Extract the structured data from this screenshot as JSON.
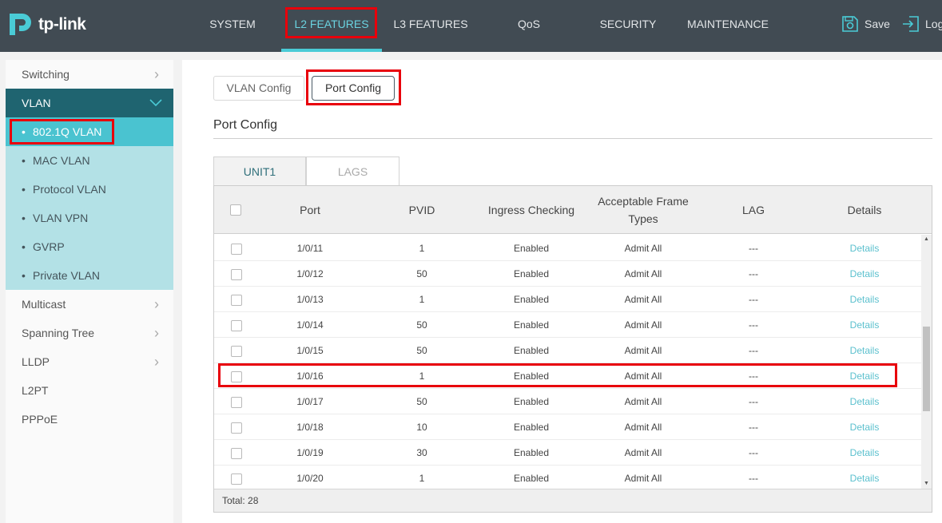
{
  "brand": {
    "name": "tp-link"
  },
  "nav": {
    "items": [
      "SYSTEM",
      "L2 FEATURES",
      "L3 FEATURES",
      "QoS",
      "SECURITY",
      "MAINTENANCE"
    ],
    "active": "L2 FEATURES",
    "save_label": "Save",
    "logout_label": "Log"
  },
  "sidebar": {
    "items": [
      {
        "label": "Switching"
      },
      {
        "label": "VLAN"
      },
      {
        "label": "Multicast"
      },
      {
        "label": "Spanning Tree"
      },
      {
        "label": "LLDP"
      },
      {
        "label": "L2PT"
      },
      {
        "label": "PPPoE"
      }
    ],
    "vlan_sub": [
      "802.1Q VLAN",
      "MAC VLAN",
      "Protocol VLAN",
      "VLAN VPN",
      "GVRP",
      "Private VLAN"
    ],
    "active_sub": "802.1Q VLAN"
  },
  "main": {
    "subtabs": [
      "VLAN Config",
      "Port Config"
    ],
    "active_subtab": "Port Config",
    "section_title": "Port Config",
    "unit_tabs": [
      "UNIT1",
      "LAGS"
    ],
    "active_unit_tab": "UNIT1",
    "table": {
      "headers": [
        "Port",
        "PVID",
        "Ingress Checking",
        "Acceptable Frame Types",
        "LAG",
        "Details"
      ],
      "rows": [
        {
          "port": "1/0/11",
          "pvid": "1",
          "ingress": "Enabled",
          "frame": "Admit All",
          "lag": "---",
          "details": "Details"
        },
        {
          "port": "1/0/12",
          "pvid": "50",
          "ingress": "Enabled",
          "frame": "Admit All",
          "lag": "---",
          "details": "Details"
        },
        {
          "port": "1/0/13",
          "pvid": "1",
          "ingress": "Enabled",
          "frame": "Admit All",
          "lag": "---",
          "details": "Details"
        },
        {
          "port": "1/0/14",
          "pvid": "50",
          "ingress": "Enabled",
          "frame": "Admit All",
          "lag": "---",
          "details": "Details"
        },
        {
          "port": "1/0/15",
          "pvid": "50",
          "ingress": "Enabled",
          "frame": "Admit All",
          "lag": "---",
          "details": "Details"
        },
        {
          "port": "1/0/16",
          "pvid": "1",
          "ingress": "Enabled",
          "frame": "Admit All",
          "lag": "---",
          "details": "Details"
        },
        {
          "port": "1/0/17",
          "pvid": "50",
          "ingress": "Enabled",
          "frame": "Admit All",
          "lag": "---",
          "details": "Details"
        },
        {
          "port": "1/0/18",
          "pvid": "10",
          "ingress": "Enabled",
          "frame": "Admit All",
          "lag": "---",
          "details": "Details"
        },
        {
          "port": "1/0/19",
          "pvid": "30",
          "ingress": "Enabled",
          "frame": "Admit All",
          "lag": "---",
          "details": "Details"
        },
        {
          "port": "1/0/20",
          "pvid": "1",
          "ingress": "Enabled",
          "frame": "Admit All",
          "lag": "---",
          "details": "Details"
        }
      ],
      "highlighted_port": "1/0/16",
      "footer": "Total: 28"
    }
  },
  "colors": {
    "topbar": "#414b53",
    "accent": "#4acbd6",
    "highlight": "#e8000b",
    "sidebar_active": "#1f6470",
    "link": "#5bc0ce"
  },
  "icons": [
    "save-icon",
    "logout-icon",
    "chevron-right-icon",
    "chevron-down-icon"
  ]
}
